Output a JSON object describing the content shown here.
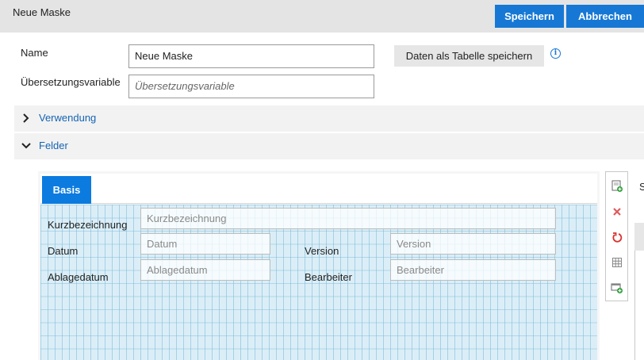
{
  "header": {
    "title": "Neue Maske",
    "save_label": "Speichern",
    "cancel_label": "Abbrechen"
  },
  "form": {
    "name_label": "Name",
    "name_value": "Neue Maske",
    "translation_label": "Übersetzungsvariable",
    "translation_placeholder": "Übersetzungsvariable",
    "save_table_label": "Daten als Tabelle speichern",
    "info_icon": "info-icon"
  },
  "sections": {
    "usage": {
      "label": "Verwendung",
      "expanded": false
    },
    "fields": {
      "label": "Felder",
      "expanded": true
    }
  },
  "designer": {
    "tab_label": "Basis",
    "fields": {
      "short_label": "Kurzbezeichnung",
      "short_placeholder": "Kurzbezeichnung",
      "date_label": "Datum",
      "date_placeholder": "Datum",
      "version_label": "Version",
      "version_placeholder": "Version",
      "filed_label": "Ablagedatum",
      "filed_placeholder": "Ablagedatum",
      "editor_label": "Bearbeiter",
      "editor_placeholder": "Bearbeiter"
    },
    "toolbar": [
      "add-page-icon",
      "delete-icon",
      "undo-icon",
      "grid-icon",
      "add-field-icon"
    ]
  },
  "right_panel": {
    "label_fragment": "S"
  },
  "colors": {
    "accent": "#1678d4",
    "link": "#1464b4",
    "delete": "#e05a5a",
    "undo": "#d9302c",
    "add": "#2e9e3a"
  }
}
